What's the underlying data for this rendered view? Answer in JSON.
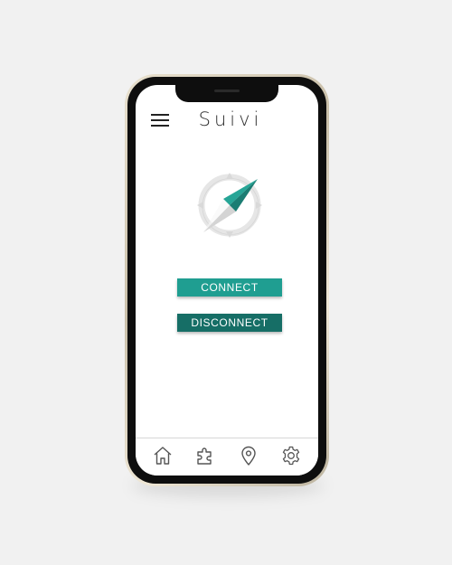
{
  "app": {
    "title": "Suivi"
  },
  "buttons": {
    "connect_label": "CONNECT",
    "disconnect_label": "DISCONNECT"
  },
  "tabs": [
    {
      "icon": "home-icon"
    },
    {
      "icon": "puzzle-icon"
    },
    {
      "icon": "location-pin-icon"
    },
    {
      "icon": "gear-icon"
    }
  ],
  "colors": {
    "accent": "#1f9e91",
    "accent_dark": "#166e66",
    "compass_gray": "#e3e3e3"
  }
}
